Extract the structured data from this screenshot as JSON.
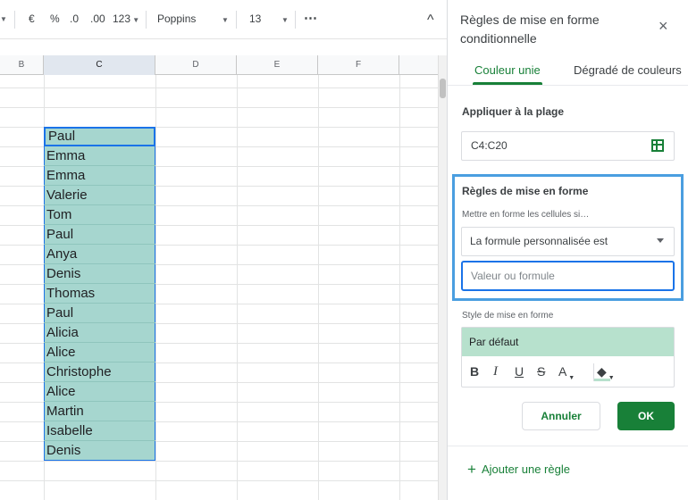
{
  "toolbar": {
    "currency": "€",
    "percent": "%",
    "decrease_decimals": ".0",
    "increase_decimals": ".00",
    "more_formats": "123",
    "font": "Poppins",
    "font_size": "13",
    "more": "⋯",
    "collapse": "^"
  },
  "sheet": {
    "columns": [
      "B",
      "C",
      "D",
      "E",
      "F"
    ],
    "selected_column": "C",
    "cells": [
      "Paul",
      "Emma",
      "Emma",
      "Valerie",
      "Tom",
      "Paul",
      "Anya",
      "Denis",
      "Thomas",
      "Paul",
      "Alicia",
      "Alice",
      "Christophe",
      "Alice",
      "Martin",
      "Isabelle",
      "Denis"
    ],
    "highlight_color": "#a6d6cf"
  },
  "panel": {
    "title": "Règles de mise en forme conditionnelle",
    "close": "×",
    "tabs": {
      "solid": "Couleur unie",
      "gradient": "Dégradé de couleurs"
    },
    "apply_range_label": "Appliquer à la plage",
    "range_value": "C4:C20",
    "rules_label": "Règles de mise en forme",
    "format_cells_if_label": "Mettre en forme les cellules si…",
    "condition_value": "La formule personnalisée est",
    "formula_placeholder": "Valeur ou formule",
    "style_label": "Style de mise en forme",
    "style_preview": "Par défaut",
    "style_buttons": {
      "bold": "B",
      "italic": "I",
      "underline": "U",
      "strike": "S",
      "text_color": "A",
      "fill_color": "◆"
    },
    "cancel": "Annuler",
    "ok": "OK",
    "add_rule": "Ajouter une règle",
    "add_rule_icon": "+",
    "accent_color": "#188038",
    "preview_fill": "#b7e1cd"
  }
}
